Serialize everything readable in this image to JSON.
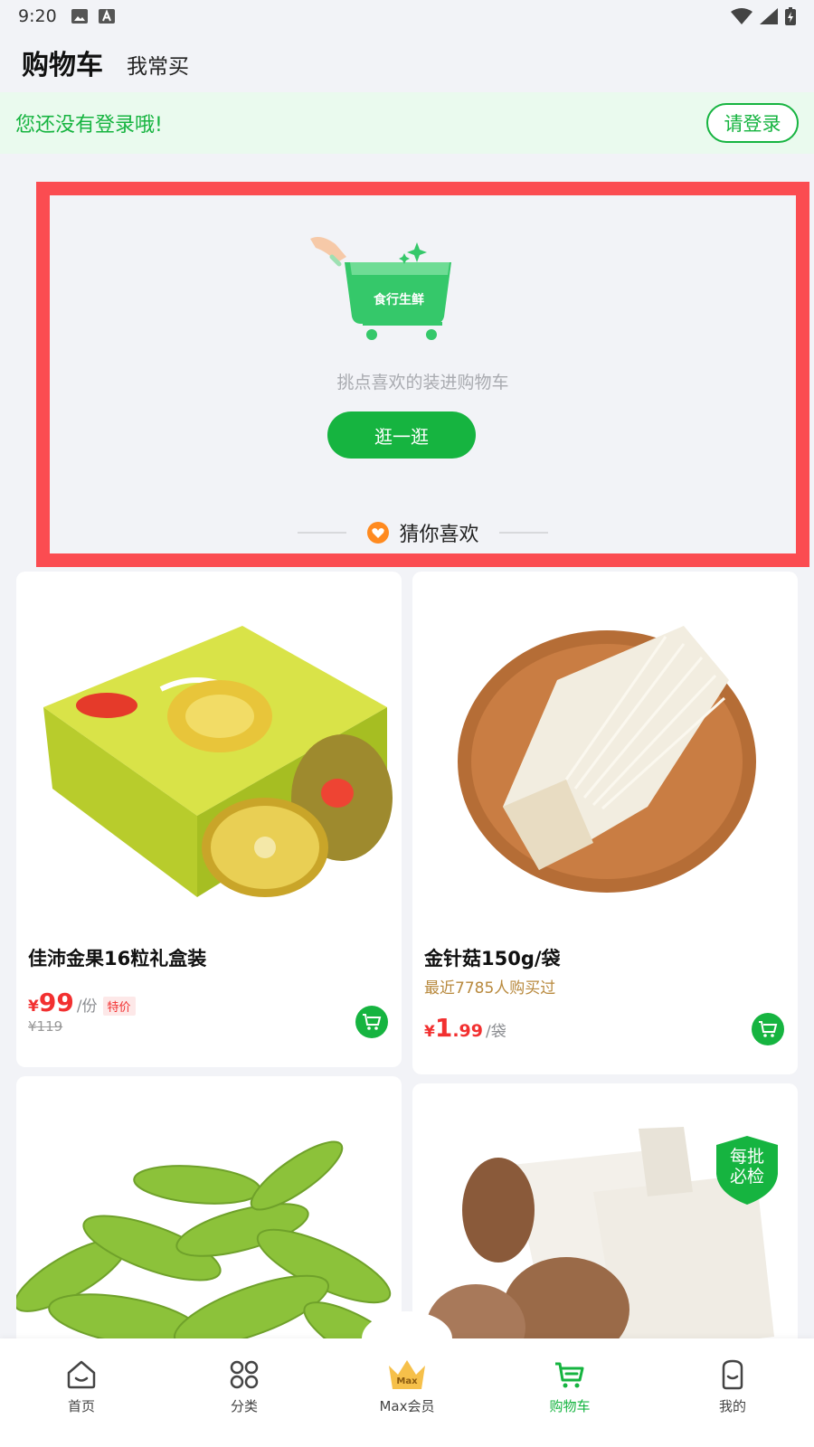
{
  "status_bar": {
    "time": "9:20"
  },
  "header": {
    "title": "购物车",
    "tab_frequent": "我常买"
  },
  "login_banner": {
    "message": "您还没有登录哦!",
    "button": "请登录"
  },
  "empty_cart": {
    "brand": "食行生鲜",
    "text": "挑点喜欢的装进购物车",
    "button": "逛一逛",
    "recommend_title": "猜你喜欢"
  },
  "products": [
    {
      "name": "佳沛金果16粒礼盒装",
      "currency": "¥",
      "price_int": "99",
      "price_dec": "",
      "unit": "/份",
      "tag": "特价",
      "original_price": "¥119",
      "sub": ""
    },
    {
      "name": "金针菇150g/袋",
      "currency": "¥",
      "price_int": "1",
      "price_dec": ".99",
      "unit": "/袋",
      "tag": "",
      "original_price": "",
      "sub": "最近7785人购买过"
    },
    {
      "name": "",
      "badge": ""
    },
    {
      "name": "",
      "badge": "每批必检"
    }
  ],
  "bottom_nav": [
    {
      "label": "首页",
      "icon": "home-icon"
    },
    {
      "label": "分类",
      "icon": "category-icon"
    },
    {
      "label": "Max会员",
      "icon": "crown-icon",
      "icon_text": "Max"
    },
    {
      "label": "购物车",
      "icon": "cart-icon",
      "active": true
    },
    {
      "label": "我的",
      "icon": "profile-icon"
    }
  ],
  "colors": {
    "brand_green": "#16b440",
    "price_red": "#f23030",
    "highlight_border": "#fb4c51"
  }
}
